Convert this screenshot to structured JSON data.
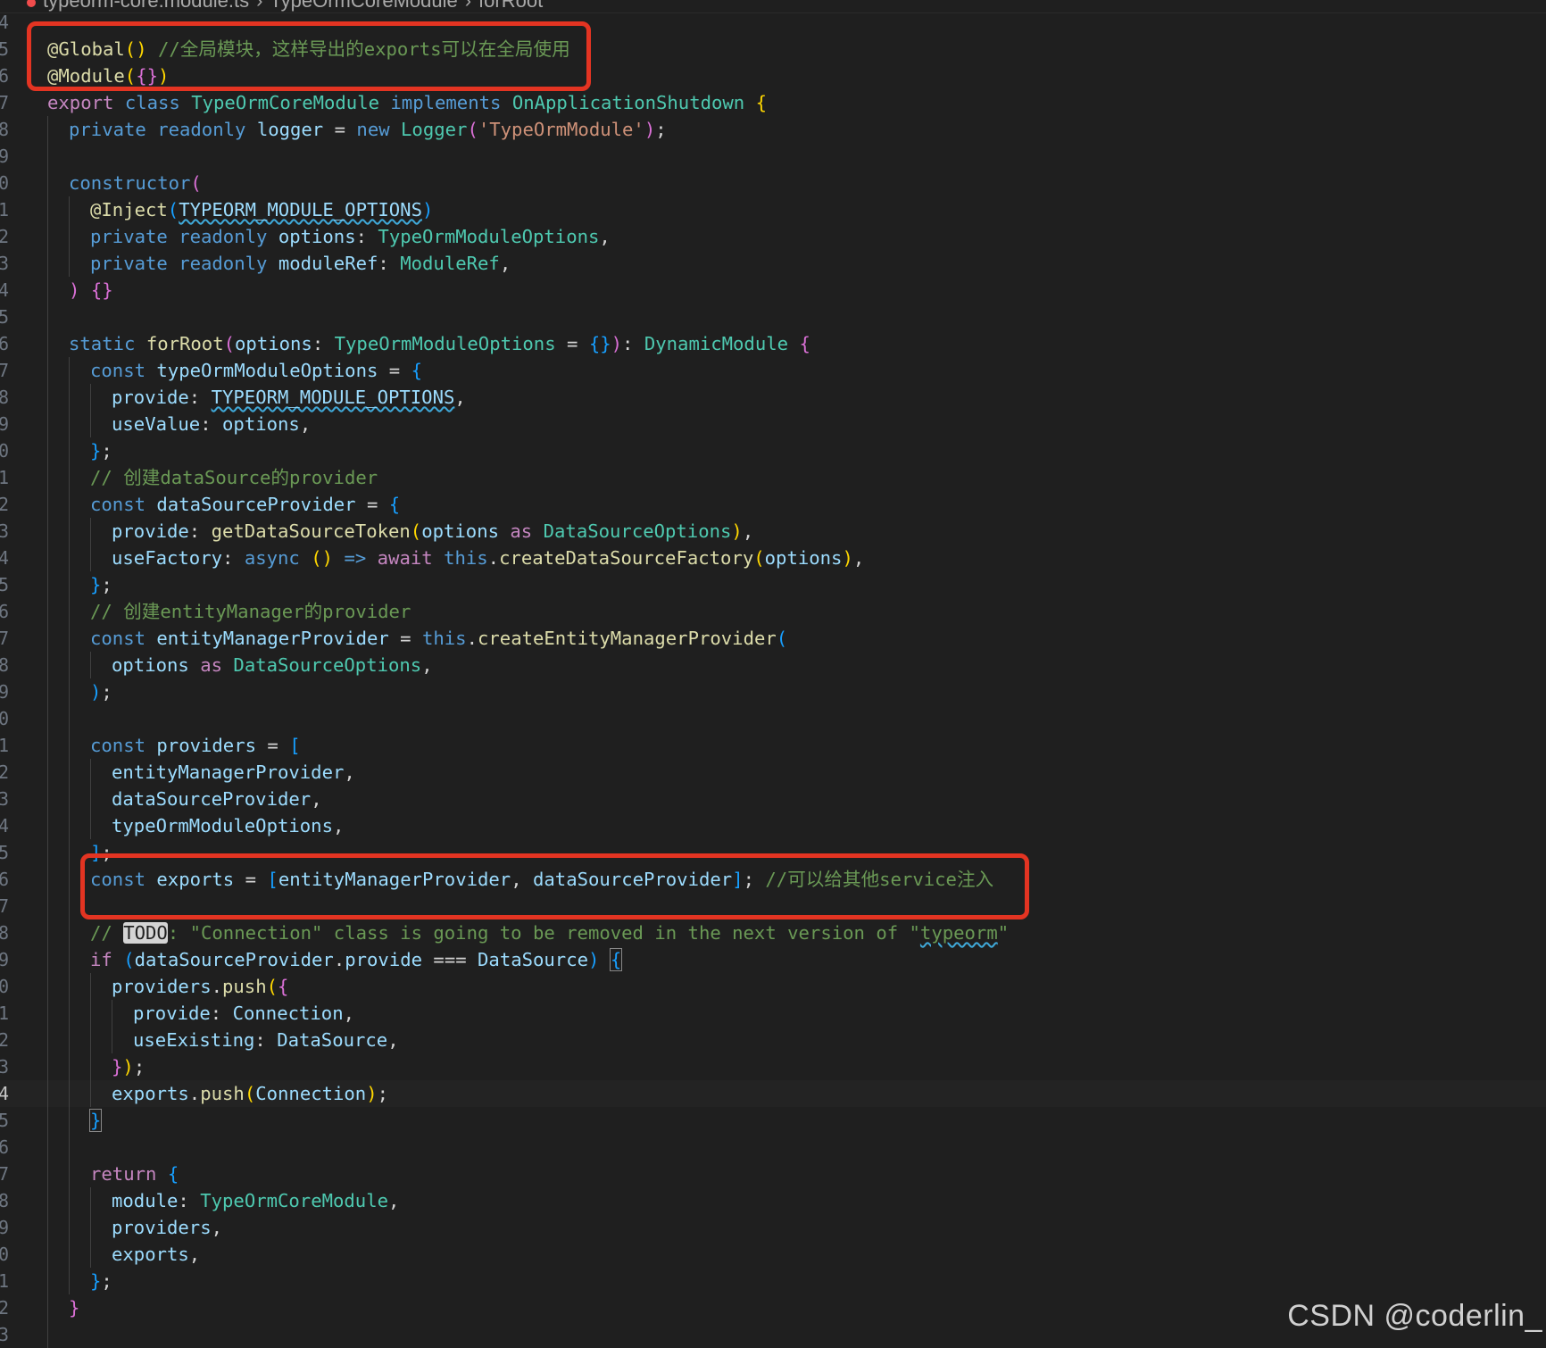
{
  "breadcrumb": {
    "file": "typeorm-core.module.ts",
    "class": "TypeOrmCoreModule",
    "method": "forRoot"
  },
  "gutter": {
    "line_numbers": [
      "4",
      "5",
      "6",
      "7",
      "8",
      "9",
      "0",
      "1",
      "2",
      "3",
      "4",
      "5",
      "6",
      "7",
      "8",
      "9",
      "0",
      "1",
      "2",
      "3",
      "4",
      "5",
      "6",
      "7",
      "8",
      "9",
      "0",
      "1",
      "2",
      "3",
      "4",
      "5",
      "6",
      "7",
      "8",
      "9",
      "0",
      "1",
      "2",
      "3",
      "4",
      "5",
      "6",
      "7",
      "8",
      "9",
      "0",
      "1",
      "2",
      "3"
    ]
  },
  "code": {
    "l05_a": "@Global",
    "l05_b": "()",
    "l05_c": " //全局模块，这样导出的exports可以在全局使用",
    "l06_a": "@Module",
    "l06_b": "(",
    "l06_c": "{}",
    "l06_d": ")",
    "l07_export": "export",
    "l07_class": "class",
    "l07_name": "TypeOrmCoreModule",
    "l07_impl": "implements",
    "l07_iface": "OnApplicationShutdown",
    "l07_brace": "{",
    "l08_private": "private",
    "l08_readonly": "readonly",
    "l08_logger": "logger",
    "l08_eq": " = ",
    "l08_new": "new",
    "l08_Logger": "Logger",
    "l08_open": "(",
    "l08_str": "'TypeOrmModule'",
    "l08_close": ")",
    "l08_semi": ";",
    "l10_ctor": "constructor",
    "l10_open": "(",
    "l11_inject": "@Inject",
    "l11_open": "(",
    "l11_const": "TYPEORM_MODULE_OPTIONS",
    "l11_close": ")",
    "l12_private": "private",
    "l12_readonly": "readonly",
    "l12_param": "options",
    "l12_colon": ": ",
    "l12_type": "TypeOrmModuleOptions",
    "l12_comma": ",",
    "l13_private": "private",
    "l13_readonly": "readonly",
    "l13_param": "moduleRef",
    "l13_colon": ": ",
    "l13_type": "ModuleRef",
    "l13_comma": ",",
    "l14_close": ")",
    "l14_body": "{}",
    "l16_static": "static",
    "l16_fn": "forRoot",
    "l16_open": "(",
    "l16_param": "options",
    "l16_colon": ": ",
    "l16_type": "TypeOrmModuleOptions",
    "l16_eq": " = ",
    "l16_default": "{}",
    "l16_close": ")",
    "l16_colon2": ": ",
    "l16_ret": "DynamicModule",
    "l16_brace": "{",
    "l17_const": "const",
    "l17_name": "typeOrmModuleOptions",
    "l17_eq": " = ",
    "l17_brace": "{",
    "l18_key": "provide",
    "l18_colon": ": ",
    "l18_val": "TYPEORM_MODULE_OPTIONS",
    "l18_comma": ",",
    "l19_key": "useValue",
    "l19_colon": ": ",
    "l19_val": "options",
    "l19_comma": ",",
    "l20_close": "}",
    "l20_semi": ";",
    "l21_comment": "// 创建dataSource的provider",
    "l22_const": "const",
    "l22_name": "dataSourceProvider",
    "l22_eq": " = ",
    "l22_brace": "{",
    "l23_key": "provide",
    "l23_colon": ": ",
    "l23_fn": "getDataSourceToken",
    "l23_open": "(",
    "l23_arg": "options",
    "l23_as": "as",
    "l23_type": "DataSourceOptions",
    "l23_close": ")",
    "l23_comma": ",",
    "l24_key": "useFactory",
    "l24_colon": ": ",
    "l24_async": "async",
    "l24_parens": "()",
    "l24_arrow": "=>",
    "l24_await": "await",
    "l24_this": "this",
    "l24_dot": ".",
    "l24_fn": "createDataSourceFactory",
    "l24_open": "(",
    "l24_arg": "options",
    "l24_close": ")",
    "l24_comma": ",",
    "l25_close": "}",
    "l25_semi": ";",
    "l26_comment": "// 创建entityManager的provider",
    "l27_const": "const",
    "l27_name": "entityManagerProvider",
    "l27_eq": " = ",
    "l27_this": "this",
    "l27_dot": ".",
    "l27_fn": "createEntityManagerProvider",
    "l27_open": "(",
    "l28_arg": "options",
    "l28_as": "as",
    "l28_type": "DataSourceOptions",
    "l28_comma": ",",
    "l29_close": ")",
    "l29_semi": ";",
    "l31_const": "const",
    "l31_name": "providers",
    "l31_eq": " = ",
    "l31_open": "[",
    "l32_item": "entityManagerProvider",
    "l32_comma": ",",
    "l33_item": "dataSourceProvider",
    "l33_comma": ",",
    "l34_item": "typeOrmModuleOptions",
    "l34_comma": ",",
    "l35_close": "]",
    "l35_semi": ";",
    "l36_const": "const",
    "l36_name": "exports",
    "l36_eq": " = ",
    "l36_open": "[",
    "l36_a": "entityManagerProvider",
    "l36_sep": ", ",
    "l36_b": "dataSourceProvider",
    "l36_close": "]",
    "l36_semi": ";",
    "l36_comment": " //可以给其他service注入",
    "l38_c1": "// ",
    "l38_todo": "TODO",
    "l38_c2": ": \"Connection\" class is going to be removed in the next version of \"",
    "l38_c3": "typeorm",
    "l38_c4": "\"",
    "l39_if": "if",
    "l39_open": "(",
    "l39_obj": "dataSourceProvider",
    "l39_dot": ".",
    "l39_prop": "provide",
    "l39_op": " === ",
    "l39_type": "DataSource",
    "l39_close": ")",
    "l39_brace": "{",
    "l40_obj": "providers",
    "l40_dot": ".",
    "l40_fn": "push",
    "l40_open": "(",
    "l40_brace": "{",
    "l41_key": "provide",
    "l41_colon": ": ",
    "l41_val": "Connection",
    "l41_comma": ",",
    "l42_key": "useExisting",
    "l42_colon": ": ",
    "l42_val": "DataSource",
    "l42_comma": ",",
    "l43_brace": "}",
    "l43_close": ")",
    "l43_semi": ";",
    "l44_obj": "exports",
    "l44_dot": ".",
    "l44_fn": "push",
    "l44_open": "(",
    "l44_arg": "Connection",
    "l44_close": ")",
    "l44_semi": ";",
    "l45_brace": "}",
    "l47_return": "return",
    "l47_brace": "{",
    "l48_key": "module",
    "l48_colon": ": ",
    "l48_val": "TypeOrmCoreModule",
    "l48_comma": ",",
    "l49_key": "providers",
    "l49_comma": ",",
    "l50_key": "exports",
    "l50_comma": ",",
    "l51_brace": "}",
    "l51_semi": ";",
    "l52_brace": "}"
  },
  "watermark": "CSDN @coderlin_",
  "colors": {
    "background": "#1f1f1f",
    "annotation_box": "#e33422",
    "keyword": "#569cd6",
    "type": "#4ec9b0",
    "function": "#dcdcaa",
    "variable": "#9cdcfe",
    "string": "#ce9178",
    "comment": "#6a9955",
    "control": "#c586c0"
  }
}
